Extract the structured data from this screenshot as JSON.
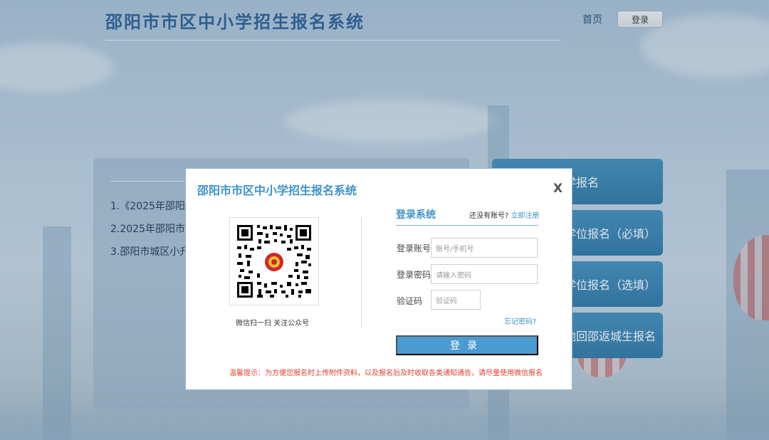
{
  "header": {
    "site_title": "邵阳市市区中小学招生报名系统",
    "nav_home": "首页",
    "nav_login": "登录"
  },
  "notices": [
    "1.《2025年邵阳市",
    "2.2025年邵阳市区",
    "3.邵阳市城区小升初"
  ],
  "side_buttons": [
    "学报名",
    "区学位报名（必填）",
    "位学位报名（选填）",
    "地回邵返城生报名"
  ],
  "modal": {
    "title": "邵阳市市区中小学招生报名系统",
    "close": "X",
    "qr_caption": "微信扫一扫  关注公众号",
    "login_heading": "登录系统",
    "no_account": "还没有账号?",
    "register_link": "立即注册",
    "account_label": "登录账号",
    "account_placeholder": "账号/手机号",
    "password_label": "登录密码",
    "password_placeholder": "请输入密码",
    "captcha_label": "验证码",
    "captcha_placeholder": "验证码",
    "forgot_password": "忘记密码?",
    "submit": "登录",
    "tip": "温馨提示：为方便您报名时上传附件资料，以及报名后及时收取各类通知通告，请尽量使用微信报名"
  },
  "colors": {
    "accent": "#3e93c9",
    "button": "#4a9bd1",
    "warning_text": "#e23b2e",
    "side_button": "#2d77a6"
  }
}
